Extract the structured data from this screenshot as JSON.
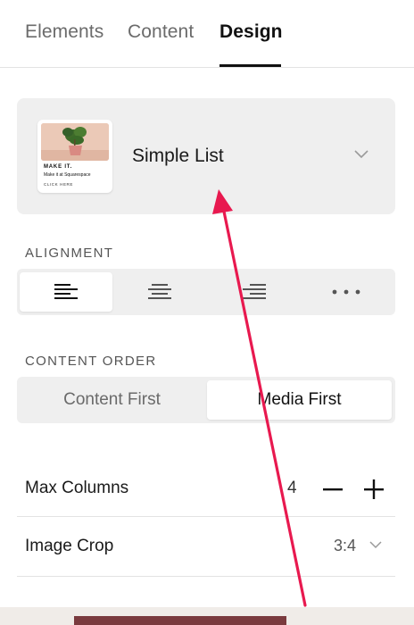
{
  "tabs": [
    {
      "label": "Elements"
    },
    {
      "label": "Content"
    },
    {
      "label": "Design"
    }
  ],
  "active_tab": "Design",
  "layout": {
    "title": "Simple List",
    "thumbnail": {
      "heading": "MAKE IT.",
      "subtext": "Make it at Squarespace",
      "cta": "CLICK HERE"
    }
  },
  "alignment": {
    "label": "ALIGNMENT",
    "options": [
      "align-left",
      "align-center",
      "align-right",
      "more"
    ],
    "selected": "align-left"
  },
  "content_order": {
    "label": "CONTENT ORDER",
    "options": [
      {
        "label": "Content First"
      },
      {
        "label": "Media First"
      }
    ],
    "selected": "Media First"
  },
  "max_columns": {
    "label": "Max Columns",
    "value": "4"
  },
  "image_crop": {
    "label": "Image Crop",
    "value": "3:4"
  },
  "colors": {
    "accent_arrow": "#e8194f",
    "panel_bg": "#efefef",
    "text_primary": "#1a1a1a"
  }
}
